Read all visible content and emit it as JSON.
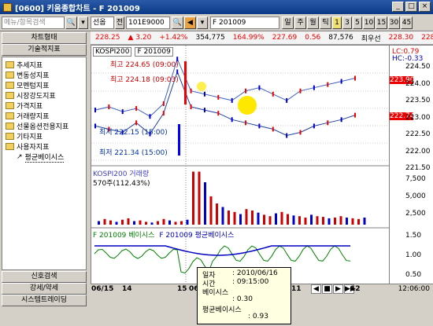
{
  "window": {
    "title": "[0600] 키움종합차트 - F 201009"
  },
  "toolbar": {
    "menu_search_placeholder": "메뉴/항목검색",
    "mode_select": "선옵",
    "tab_label": "전",
    "code_value": "101E9000",
    "name_value": "F 201009",
    "period_buttons": [
      "일",
      "주",
      "월",
      "틱",
      "1",
      "3",
      "5",
      "10",
      "15",
      "30",
      "45"
    ]
  },
  "quote": {
    "price": "228.25",
    "change": "▲ 3.20",
    "rate": "+1.42%",
    "volume": "354,775",
    "vol_rate": "164.99%",
    "basis": "227.69",
    "diff": "0.56",
    "oi": "87,576",
    "label_choi": "최우선",
    "bid": "228.30",
    "ask": "228.35"
  },
  "sidebar": {
    "chart_type": "차트형태",
    "tech_indicator": "기술적지표",
    "items": [
      "추세지표",
      "변동성지표",
      "모멘텀지표",
      "시장강도지표",
      "가격지표",
      "거래량지표",
      "선물옵션전용지표",
      "기타지표",
      "사용자지표",
      "평균베이시스"
    ],
    "signal_search": "신호검색",
    "strength": "강세/약세",
    "system_trading": "시스템트레이딩"
  },
  "chart": {
    "main_labels": {
      "kospi": "KOSPI200",
      "future": "F 201009"
    },
    "annotations": {
      "high1": "최고 224.65 (09:00)",
      "high2": "최고 224.18 (09:03)",
      "low1": "최저 222.15 (15:00)",
      "low2": "최저 221.34 (15:00)"
    },
    "volume_label": "KOSPI200 거래량",
    "volume_value": "570주(112.43%)",
    "basis_label1": "F 201009 베이시스",
    "basis_label2": "F 201009 평균베이시스",
    "right_top": {
      "lc": "LC:0.79",
      "hc": "HC:-0.33"
    },
    "price_ticks": [
      "224.50",
      "224.00",
      "223.50",
      "223.00",
      "222.50",
      "222.00",
      "221.50"
    ],
    "price_tag1": "223.90",
    "price_tag2": "222.74",
    "volume_ticks": [
      "7,500",
      "5,000",
      "2,500"
    ],
    "basis_ticks": [
      "1.50",
      "1.00",
      "0.50"
    ],
    "x_ticks": [
      "06/15",
      "14",
      "15",
      "06/16",
      "11",
      "12"
    ],
    "time_label": "12:06:00"
  },
  "tooltip": {
    "date_label": "일자",
    "date_value": ": 2010/06/16",
    "time_label": "시간",
    "time_value": ": 09:15:00",
    "basis_label": "베이시스",
    "basis_value": ": 0.30",
    "avg_label": "평균베이시스",
    "avg_value": ": 0.93"
  },
  "chart_data": {
    "type": "line",
    "series": [
      {
        "name": "KOSPI200",
        "values": [
          222.9,
          223.0,
          222.85,
          222.95,
          222.7,
          223.1,
          224.5,
          223.5,
          223.4,
          223.3,
          223.2,
          223.5,
          223.6,
          223.4,
          223.2,
          223.5,
          223.6,
          223.7,
          223.8,
          223.9
        ]
      },
      {
        "name": "F 201009",
        "values": [
          222.4,
          222.3,
          222.2,
          222.5,
          222.15,
          222.8,
          224.1,
          223.0,
          222.9,
          222.8,
          222.6,
          222.5,
          222.4,
          222.3,
          222.1,
          222.2,
          222.4,
          222.5,
          222.6,
          222.74
        ]
      }
    ],
    "ylim": [
      221.3,
      224.8
    ]
  },
  "colors": {
    "accent": "#ffe800",
    "blue": "#0000ff",
    "red": "#ff0000"
  }
}
